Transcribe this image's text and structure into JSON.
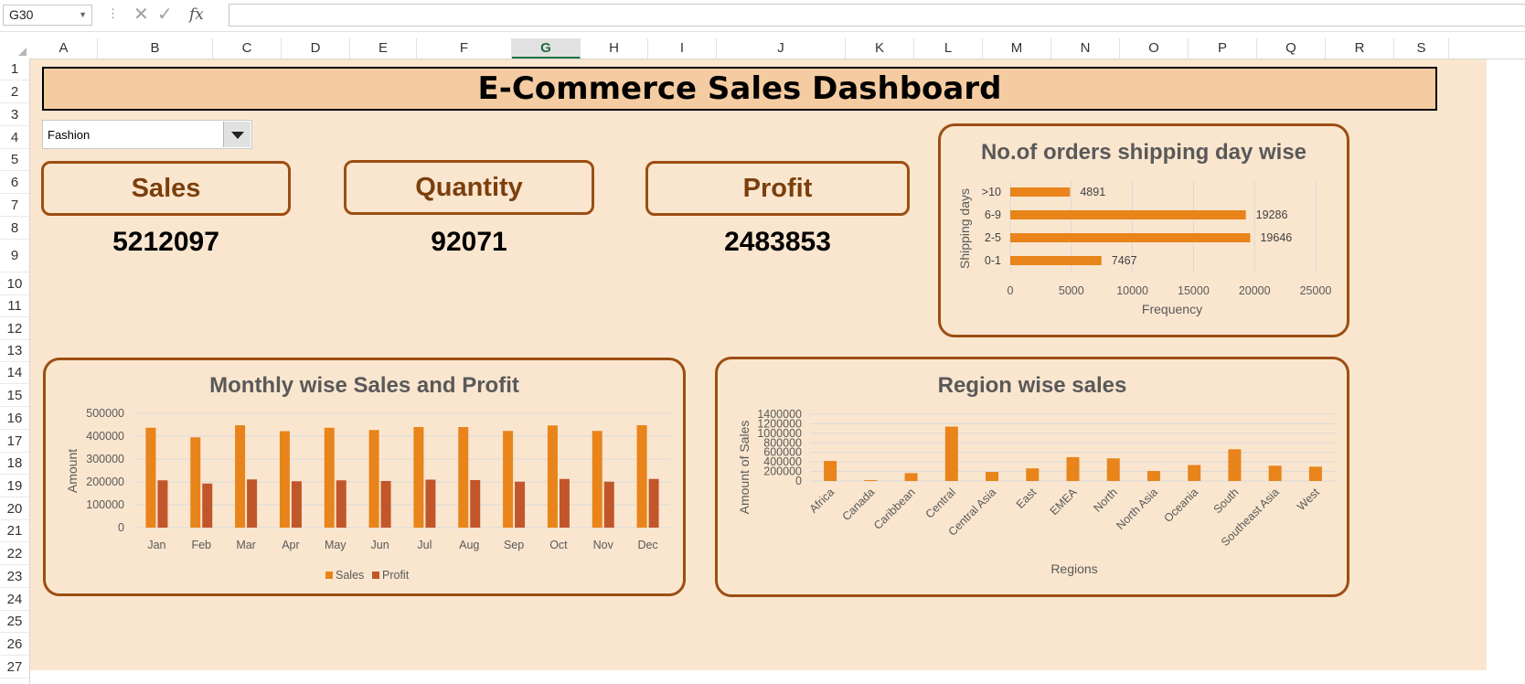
{
  "formula_bar": {
    "name_box": "G30",
    "formula": ""
  },
  "columns": [
    "A",
    "B",
    "C",
    "D",
    "E",
    "F",
    "G",
    "H",
    "I",
    "J",
    "K",
    "L",
    "M",
    "N",
    "O",
    "P",
    "Q",
    "R",
    "S"
  ],
  "rows": [
    "1",
    "2",
    "3",
    "4",
    "5",
    "6",
    "7",
    "8",
    "9",
    "10",
    "11",
    "12",
    "13",
    "14",
    "15",
    "16",
    "17",
    "18",
    "19",
    "20",
    "21",
    "22",
    "23",
    "24",
    "25",
    "26",
    "27"
  ],
  "dashboard": {
    "title": "E-Commerce Sales Dashboard",
    "category_filter": "Fashion",
    "kpis": [
      {
        "label": "Sales",
        "value": "5212097"
      },
      {
        "label": "Quantity",
        "value": "92071"
      },
      {
        "label": "Profit",
        "value": "2483853"
      }
    ],
    "colors": {
      "background": "#fae6cf",
      "title_fill": "#f5cba1",
      "border": "#9c4e13",
      "sales_bar": "#e8841a",
      "profit_bar": "#c2562b"
    }
  },
  "chart_data": [
    {
      "type": "bar",
      "orientation": "horizontal",
      "title": "No.of orders shipping day wise",
      "categories": [
        ">10",
        "6-9",
        "2-5",
        "0-1"
      ],
      "values": [
        4891,
        19286,
        19646,
        7467
      ],
      "data_labels": [
        "4891",
        "19286",
        "19646",
        "7467"
      ],
      "xlabel": "Frequency",
      "ylabel": "Shipping days",
      "xlim": [
        0,
        25000
      ],
      "xticks": [
        "0",
        "5000",
        "10000",
        "15000",
        "20000",
        "25000"
      ],
      "grid": true
    },
    {
      "type": "bar",
      "title": "Monthly wise Sales and Profit",
      "categories": [
        "Jan",
        "Feb",
        "Mar",
        "Apr",
        "May",
        "Jun",
        "Jul",
        "Aug",
        "Sep",
        "Oct",
        "Nov",
        "Dec"
      ],
      "series": [
        {
          "name": "Sales",
          "values": [
            437000,
            395000,
            448000,
            422000,
            437000,
            427000,
            440000,
            440000,
            423000,
            447000,
            423000,
            448000
          ]
        },
        {
          "name": "Profit",
          "values": [
            207000,
            193000,
            211000,
            203000,
            207000,
            204000,
            210000,
            208000,
            201000,
            213000,
            201000,
            213000
          ]
        }
      ],
      "ylabel": "Amount",
      "ylim": [
        0,
        500000
      ],
      "yticks": [
        "0",
        "100000",
        "200000",
        "300000",
        "400000",
        "500000"
      ],
      "legend": "bottom",
      "grid": true
    },
    {
      "type": "bar",
      "title": "Region wise sales",
      "categories": [
        "Africa",
        "Canada",
        "Caribbean",
        "Central",
        "Central Asia",
        "East",
        "EMEA",
        "North",
        "North Asia",
        "Oceania",
        "South",
        "Southeast Asia",
        "West"
      ],
      "values": [
        420000,
        20000,
        165000,
        1140000,
        190000,
        265000,
        500000,
        475000,
        210000,
        335000,
        665000,
        320000,
        300000
      ],
      "xlabel": "Regions",
      "ylabel": "Amount of Sales",
      "ylim": [
        0,
        1400000
      ],
      "yticks": [
        "0",
        "200000",
        "400000",
        "600000",
        "800000",
        "1000000",
        "1200000",
        "1400000"
      ],
      "grid": true
    }
  ]
}
